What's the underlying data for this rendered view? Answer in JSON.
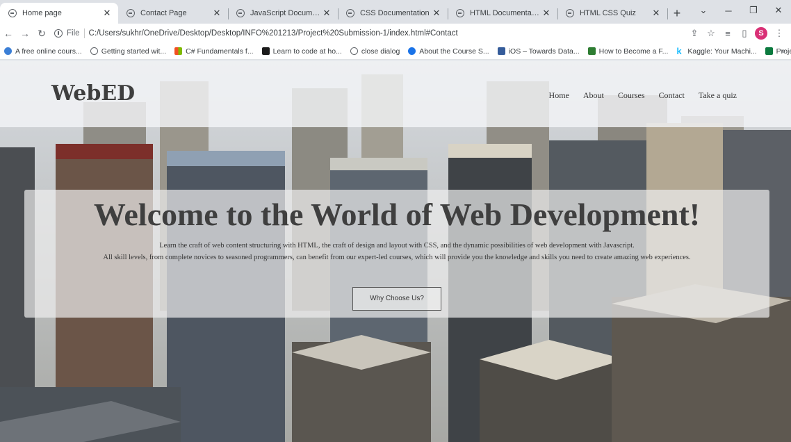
{
  "browser": {
    "tabs": [
      {
        "title": "Home page",
        "active": true
      },
      {
        "title": "Contact Page",
        "active": false
      },
      {
        "title": "JavaScript Documentation",
        "active": false
      },
      {
        "title": "CSS Documentation",
        "active": false
      },
      {
        "title": "HTML Documentation",
        "active": false
      },
      {
        "title": "HTML CSS Quiz",
        "active": false
      }
    ],
    "new_tab_label": "+",
    "address": {
      "scheme": "File",
      "url": "C:/Users/sukhr/OneDrive/Desktop/Desktop/INFO%201213/Project%20Submission-1/index.html#Contact"
    },
    "profile_initial": "S",
    "bookmarks": [
      {
        "label": "A free online cours...",
        "icon_color": "#3b7fd6"
      },
      {
        "label": "Getting started wit...",
        "icon_color": "#5f6368"
      },
      {
        "label": "C# Fundamentals f...",
        "icon_color": "#f25022"
      },
      {
        "label": "Learn to code at ho...",
        "icon_color": "#1b1b1b"
      },
      {
        "label": "close dialog",
        "icon_color": "#5f6368"
      },
      {
        "label": "About the Course S...",
        "icon_color": "#1a73e8"
      },
      {
        "label": "iOS – Towards Data...",
        "icon_color": "#355c9a"
      },
      {
        "label": "How to Become a F...",
        "icon_color": "#2e7d32"
      },
      {
        "label": "Kaggle: Your Machi...",
        "icon_color": "#20beff"
      },
      {
        "label": "Project English Clas...",
        "icon_color": "#0b7a3e"
      }
    ],
    "bookmarks_more": "»"
  },
  "site": {
    "logo": "WebED",
    "nav": [
      "Home",
      "About",
      "Courses",
      "Contact",
      "Take a quiz"
    ],
    "hero": {
      "title": "Welcome to the World of Web Development!",
      "line1": "Learn the craft of web content structuring with HTML, the craft of design and layout with CSS, and the dynamic possibilities of web development with Javascript.",
      "line2": "All skill levels, from complete novices to seasoned programmers, can benefit from our expert-led courses, which will provide you the knowledge and skills you need to create amazing web experiences.",
      "button": "Why Choose Us?"
    }
  }
}
